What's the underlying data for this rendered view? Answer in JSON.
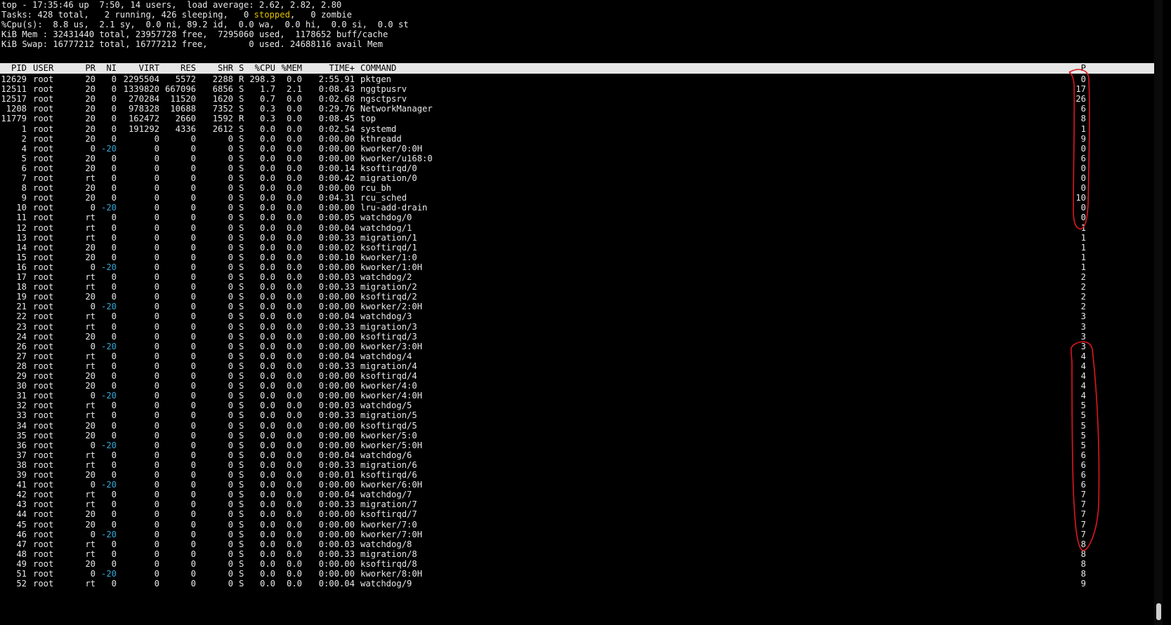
{
  "summary": {
    "line1": "top - 17:35:46 up  7:50, 14 users,  load average: 2.62, 2.82, 2.80",
    "line2_a": "Tasks: 428 total,   2 running, 426 sleeping,   0 ",
    "line2_stopped": "stopped",
    "line2_b": ",   0 zombie",
    "line3": "%Cpu(s):  8.8 us,  2.1 sy,  0.0 ni, 89.2 id,  0.0 wa,  0.0 hi,  0.0 si,  0.0 st",
    "line4": "KiB Mem : 32431440 total, 23957728 free,  7295060 used,  1178652 buff/cache",
    "line5": "KiB Swap: 16777212 total, 16777212 free,        0 used. 24688116 avail Mem"
  },
  "columns": [
    "PID",
    "USER",
    "PR",
    "NI",
    "VIRT",
    "RES",
    "SHR",
    "S",
    "%CPU",
    "%MEM",
    "TIME+",
    "COMMAND",
    "P"
  ],
  "processes": [
    [
      "12629",
      "root",
      "20",
      "0",
      "2295504",
      "5572",
      "2288",
      "R",
      "298.3",
      "0.0",
      "2:55.91",
      "pktgen",
      "0"
    ],
    [
      "12511",
      "root",
      "20",
      "0",
      "1339820",
      "667096",
      "6856",
      "S",
      "1.7",
      "2.1",
      "0:08.43",
      "nggtpusrv",
      "17"
    ],
    [
      "12517",
      "root",
      "20",
      "0",
      "270284",
      "11520",
      "1620",
      "S",
      "0.7",
      "0.0",
      "0:02.68",
      "ngsctpsrv",
      "26"
    ],
    [
      "1208",
      "root",
      "20",
      "0",
      "978328",
      "10688",
      "7352",
      "S",
      "0.3",
      "0.0",
      "0:29.76",
      "NetworkManager",
      "6"
    ],
    [
      "11779",
      "root",
      "20",
      "0",
      "162472",
      "2660",
      "1592",
      "R",
      "0.3",
      "0.0",
      "0:08.45",
      "top",
      "8"
    ],
    [
      "1",
      "root",
      "20",
      "0",
      "191292",
      "4336",
      "2612",
      "S",
      "0.0",
      "0.0",
      "0:02.54",
      "systemd",
      "1"
    ],
    [
      "2",
      "root",
      "20",
      "0",
      "0",
      "0",
      "0",
      "S",
      "0.0",
      "0.0",
      "0:00.00",
      "kthreadd",
      "9"
    ],
    [
      "4",
      "root",
      "0",
      "-20",
      "0",
      "0",
      "0",
      "S",
      "0.0",
      "0.0",
      "0:00.00",
      "kworker/0:0H",
      "0"
    ],
    [
      "5",
      "root",
      "20",
      "0",
      "0",
      "0",
      "0",
      "S",
      "0.0",
      "0.0",
      "0:00.00",
      "kworker/u168:0",
      "6"
    ],
    [
      "6",
      "root",
      "20",
      "0",
      "0",
      "0",
      "0",
      "S",
      "0.0",
      "0.0",
      "0:00.14",
      "ksoftirqd/0",
      "0"
    ],
    [
      "7",
      "root",
      "rt",
      "0",
      "0",
      "0",
      "0",
      "S",
      "0.0",
      "0.0",
      "0:00.42",
      "migration/0",
      "0"
    ],
    [
      "8",
      "root",
      "20",
      "0",
      "0",
      "0",
      "0",
      "S",
      "0.0",
      "0.0",
      "0:00.00",
      "rcu_bh",
      "0"
    ],
    [
      "9",
      "root",
      "20",
      "0",
      "0",
      "0",
      "0",
      "S",
      "0.0",
      "0.0",
      "0:04.31",
      "rcu_sched",
      "10"
    ],
    [
      "10",
      "root",
      "0",
      "-20",
      "0",
      "0",
      "0",
      "S",
      "0.0",
      "0.0",
      "0:00.00",
      "lru-add-drain",
      "0"
    ],
    [
      "11",
      "root",
      "rt",
      "0",
      "0",
      "0",
      "0",
      "S",
      "0.0",
      "0.0",
      "0:00.05",
      "watchdog/0",
      "0"
    ],
    [
      "12",
      "root",
      "rt",
      "0",
      "0",
      "0",
      "0",
      "S",
      "0.0",
      "0.0",
      "0:00.04",
      "watchdog/1",
      "1"
    ],
    [
      "13",
      "root",
      "rt",
      "0",
      "0",
      "0",
      "0",
      "S",
      "0.0",
      "0.0",
      "0:00.33",
      "migration/1",
      "1"
    ],
    [
      "14",
      "root",
      "20",
      "0",
      "0",
      "0",
      "0",
      "S",
      "0.0",
      "0.0",
      "0:00.02",
      "ksoftirqd/1",
      "1"
    ],
    [
      "15",
      "root",
      "20",
      "0",
      "0",
      "0",
      "0",
      "S",
      "0.0",
      "0.0",
      "0:00.10",
      "kworker/1:0",
      "1"
    ],
    [
      "16",
      "root",
      "0",
      "-20",
      "0",
      "0",
      "0",
      "S",
      "0.0",
      "0.0",
      "0:00.00",
      "kworker/1:0H",
      "1"
    ],
    [
      "17",
      "root",
      "rt",
      "0",
      "0",
      "0",
      "0",
      "S",
      "0.0",
      "0.0",
      "0:00.03",
      "watchdog/2",
      "2"
    ],
    [
      "18",
      "root",
      "rt",
      "0",
      "0",
      "0",
      "0",
      "S",
      "0.0",
      "0.0",
      "0:00.33",
      "migration/2",
      "2"
    ],
    [
      "19",
      "root",
      "20",
      "0",
      "0",
      "0",
      "0",
      "S",
      "0.0",
      "0.0",
      "0:00.00",
      "ksoftirqd/2",
      "2"
    ],
    [
      "21",
      "root",
      "0",
      "-20",
      "0",
      "0",
      "0",
      "S",
      "0.0",
      "0.0",
      "0:00.00",
      "kworker/2:0H",
      "2"
    ],
    [
      "22",
      "root",
      "rt",
      "0",
      "0",
      "0",
      "0",
      "S",
      "0.0",
      "0.0",
      "0:00.04",
      "watchdog/3",
      "3"
    ],
    [
      "23",
      "root",
      "rt",
      "0",
      "0",
      "0",
      "0",
      "S",
      "0.0",
      "0.0",
      "0:00.33",
      "migration/3",
      "3"
    ],
    [
      "24",
      "root",
      "20",
      "0",
      "0",
      "0",
      "0",
      "S",
      "0.0",
      "0.0",
      "0:00.00",
      "ksoftirqd/3",
      "3"
    ],
    [
      "26",
      "root",
      "0",
      "-20",
      "0",
      "0",
      "0",
      "S",
      "0.0",
      "0.0",
      "0:00.00",
      "kworker/3:0H",
      "3"
    ],
    [
      "27",
      "root",
      "rt",
      "0",
      "0",
      "0",
      "0",
      "S",
      "0.0",
      "0.0",
      "0:00.04",
      "watchdog/4",
      "4"
    ],
    [
      "28",
      "root",
      "rt",
      "0",
      "0",
      "0",
      "0",
      "S",
      "0.0",
      "0.0",
      "0:00.33",
      "migration/4",
      "4"
    ],
    [
      "29",
      "root",
      "20",
      "0",
      "0",
      "0",
      "0",
      "S",
      "0.0",
      "0.0",
      "0:00.00",
      "ksoftirqd/4",
      "4"
    ],
    [
      "30",
      "root",
      "20",
      "0",
      "0",
      "0",
      "0",
      "S",
      "0.0",
      "0.0",
      "0:00.00",
      "kworker/4:0",
      "4"
    ],
    [
      "31",
      "root",
      "0",
      "-20",
      "0",
      "0",
      "0",
      "S",
      "0.0",
      "0.0",
      "0:00.00",
      "kworker/4:0H",
      "4"
    ],
    [
      "32",
      "root",
      "rt",
      "0",
      "0",
      "0",
      "0",
      "S",
      "0.0",
      "0.0",
      "0:00.03",
      "watchdog/5",
      "5"
    ],
    [
      "33",
      "root",
      "rt",
      "0",
      "0",
      "0",
      "0",
      "S",
      "0.0",
      "0.0",
      "0:00.33",
      "migration/5",
      "5"
    ],
    [
      "34",
      "root",
      "20",
      "0",
      "0",
      "0",
      "0",
      "S",
      "0.0",
      "0.0",
      "0:00.00",
      "ksoftirqd/5",
      "5"
    ],
    [
      "35",
      "root",
      "20",
      "0",
      "0",
      "0",
      "0",
      "S",
      "0.0",
      "0.0",
      "0:00.00",
      "kworker/5:0",
      "5"
    ],
    [
      "36",
      "root",
      "0",
      "-20",
      "0",
      "0",
      "0",
      "S",
      "0.0",
      "0.0",
      "0:00.00",
      "kworker/5:0H",
      "5"
    ],
    [
      "37",
      "root",
      "rt",
      "0",
      "0",
      "0",
      "0",
      "S",
      "0.0",
      "0.0",
      "0:00.04",
      "watchdog/6",
      "6"
    ],
    [
      "38",
      "root",
      "rt",
      "0",
      "0",
      "0",
      "0",
      "S",
      "0.0",
      "0.0",
      "0:00.33",
      "migration/6",
      "6"
    ],
    [
      "39",
      "root",
      "20",
      "0",
      "0",
      "0",
      "0",
      "S",
      "0.0",
      "0.0",
      "0:00.01",
      "ksoftirqd/6",
      "6"
    ],
    [
      "41",
      "root",
      "0",
      "-20",
      "0",
      "0",
      "0",
      "S",
      "0.0",
      "0.0",
      "0:00.00",
      "kworker/6:0H",
      "6"
    ],
    [
      "42",
      "root",
      "rt",
      "0",
      "0",
      "0",
      "0",
      "S",
      "0.0",
      "0.0",
      "0:00.04",
      "watchdog/7",
      "7"
    ],
    [
      "43",
      "root",
      "rt",
      "0",
      "0",
      "0",
      "0",
      "S",
      "0.0",
      "0.0",
      "0:00.33",
      "migration/7",
      "7"
    ],
    [
      "44",
      "root",
      "20",
      "0",
      "0",
      "0",
      "0",
      "S",
      "0.0",
      "0.0",
      "0:00.00",
      "ksoftirqd/7",
      "7"
    ],
    [
      "45",
      "root",
      "20",
      "0",
      "0",
      "0",
      "0",
      "S",
      "0.0",
      "0.0",
      "0:00.00",
      "kworker/7:0",
      "7"
    ],
    [
      "46",
      "root",
      "0",
      "-20",
      "0",
      "0",
      "0",
      "S",
      "0.0",
      "0.0",
      "0:00.00",
      "kworker/7:0H",
      "7"
    ],
    [
      "47",
      "root",
      "rt",
      "0",
      "0",
      "0",
      "0",
      "S",
      "0.0",
      "0.0",
      "0:00.03",
      "watchdog/8",
      "8"
    ],
    [
      "48",
      "root",
      "rt",
      "0",
      "0",
      "0",
      "0",
      "S",
      "0.0",
      "0.0",
      "0:00.33",
      "migration/8",
      "8"
    ],
    [
      "49",
      "root",
      "20",
      "0",
      "0",
      "0",
      "0",
      "S",
      "0.0",
      "0.0",
      "0:00.00",
      "ksoftirqd/8",
      "8"
    ],
    [
      "51",
      "root",
      "0",
      "-20",
      "0",
      "0",
      "0",
      "S",
      "0.0",
      "0.0",
      "0:00.00",
      "kworker/8:0H",
      "8"
    ],
    [
      "52",
      "root",
      "rt",
      "0",
      "0",
      "0",
      "0",
      "S",
      "0.0",
      "0.0",
      "0:00.04",
      "watchdog/9",
      "9"
    ]
  ],
  "colors": {
    "background": "#000000",
    "text": "#e8e8e8",
    "header_bar": "#e6e6e6",
    "negative_nice": "#35a7d6",
    "stopped": "#e0c200",
    "annotation": "#e0161f"
  }
}
